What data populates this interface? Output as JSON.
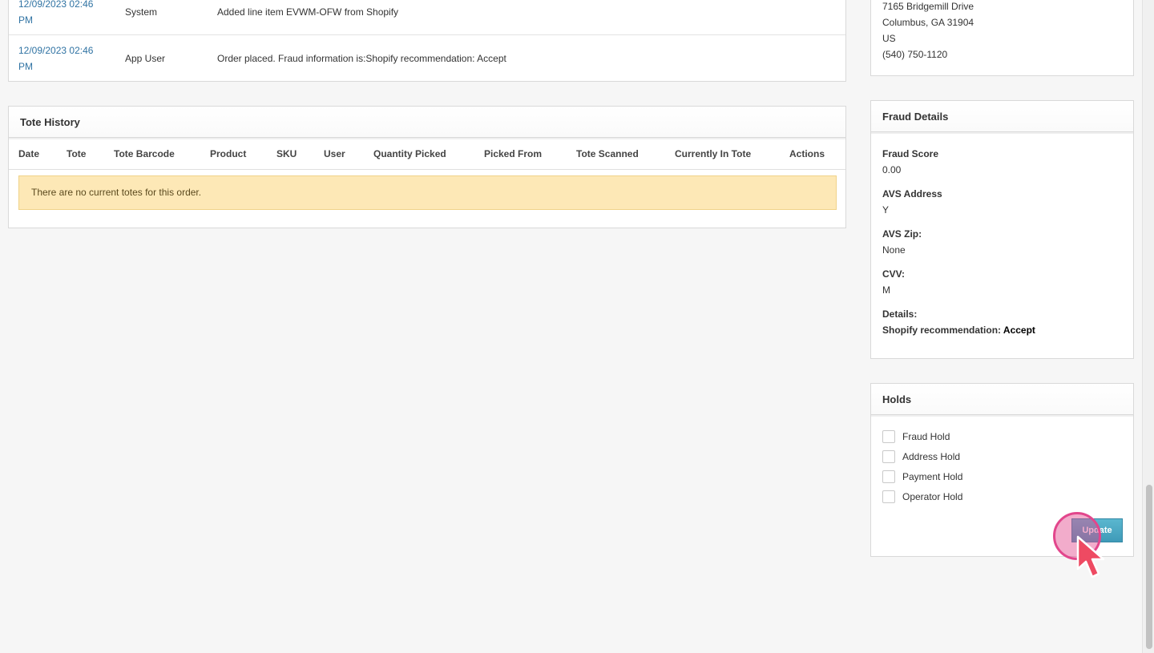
{
  "history": {
    "rows": [
      {
        "date_line1": "12/09/2023 02:46",
        "date_line2": "PM",
        "user": "System",
        "message": "Added line item EVWM-OFW from Shopify"
      },
      {
        "date_line1": "12/09/2023 02:46",
        "date_line2": "PM",
        "user": "App User",
        "message": "Order placed. Fraud information is:Shopify recommendation: Accept"
      }
    ]
  },
  "tote_history": {
    "title": "Tote History",
    "columns": [
      "Date",
      "Tote",
      "Tote Barcode",
      "Product",
      "SKU",
      "User",
      "Quantity Picked",
      "Picked From",
      "Tote Scanned",
      "Currently In Tote",
      "Actions"
    ],
    "empty_message": "There are no current totes for this order."
  },
  "address": {
    "street": "7165 Bridgemill Drive",
    "city_state_zip": "Columbus, GA 31904",
    "country": "US",
    "phone": "(540) 750-1120"
  },
  "fraud_details": {
    "title": "Fraud Details",
    "fraud_score_label": "Fraud Score",
    "fraud_score": "0.00",
    "avs_address_label": "AVS Address",
    "avs_address": "Y",
    "avs_zip_label": "AVS Zip:",
    "avs_zip": "None",
    "cvv_label": "CVV:",
    "cvv": "M",
    "details_label": "Details:",
    "details_prefix": "Shopify recommendation:",
    "details_value": "Accept"
  },
  "holds": {
    "title": "Holds",
    "items": [
      {
        "label": "Fraud Hold",
        "checked": false
      },
      {
        "label": "Address Hold",
        "checked": false
      },
      {
        "label": "Payment Hold",
        "checked": false
      },
      {
        "label": "Operator Hold",
        "checked": false
      }
    ],
    "update_label": "Update"
  },
  "colors": {
    "link": "#3073a3",
    "alert_bg": "#fde8b6",
    "button": "#4aa8c4",
    "click_indicator": "#e2468c"
  }
}
